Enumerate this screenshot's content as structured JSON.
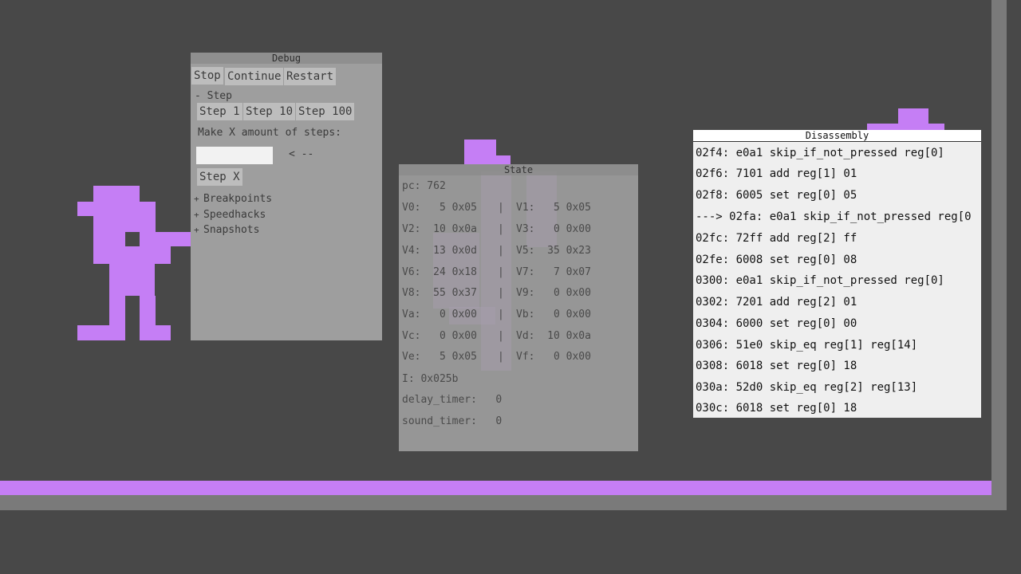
{
  "colors": {
    "background": "#484848",
    "sprite": "#c57ef5",
    "frame": "#7a7a7a",
    "debug_panel": "#9e9e9e",
    "state_panel": "#999999",
    "disassembly_panel": "#efefef"
  },
  "debug": {
    "title": "Debug",
    "buttons": {
      "stop": "Stop",
      "continue": "Continue",
      "restart": "Restart"
    },
    "step_section": "- Step",
    "step_buttons": [
      "Step 1",
      "Step 10",
      "Step 100"
    ],
    "make_steps_label": "Make X amount of steps:",
    "steps_input_value": "",
    "arrow_hint": "< --",
    "step_x_button": "Step X",
    "collapsed_sections": [
      {
        "marker": "+",
        "label": "Breakpoints"
      },
      {
        "marker": "+",
        "label": "Speedhacks"
      },
      {
        "marker": "+",
        "label": "Snapshots"
      }
    ]
  },
  "state": {
    "title": "State",
    "pc": "pc: 762",
    "registers": [
      {
        "left": "V0:   5 0x05",
        "sep": "|",
        "right": "V1:   5 0x05"
      },
      {
        "left": "V2:  10 0x0a",
        "sep": "|",
        "right": "V3:   0 0x00"
      },
      {
        "left": "V4:  13 0x0d",
        "sep": "|",
        "right": "V5:  35 0x23"
      },
      {
        "left": "V6:  24 0x18",
        "sep": "|",
        "right": "V7:   7 0x07"
      },
      {
        "left": "V8:  55 0x37",
        "sep": "|",
        "right": "V9:   0 0x00"
      },
      {
        "left": "Va:   0 0x00",
        "sep": "|",
        "right": "Vb:   0 0x00"
      },
      {
        "left": "Vc:   0 0x00",
        "sep": "|",
        "right": "Vd:  10 0x0a"
      },
      {
        "left": "Ve:   5 0x05",
        "sep": "|",
        "right": "Vf:   0 0x00"
      }
    ],
    "index": "I: 0x025b",
    "delay_timer": "delay_timer:   0",
    "sound_timer": "sound_timer:   0"
  },
  "disassembly": {
    "title": "Disassembly",
    "rows": [
      "02f4: e0a1 skip_if_not_pressed reg[0]",
      "02f6: 7101 add reg[1] 01",
      "02f8: 6005 set reg[0] 05",
      "---> 02fa: e0a1 skip_if_not_pressed reg[0",
      "02fc: 72ff add reg[2] ff",
      "02fe: 6008 set reg[0] 08",
      "0300: e0a1 skip_if_not_pressed reg[0]",
      "0302: 7201 add reg[2] 01",
      "0304: 6000 set reg[0] 00",
      "0306: 51e0 skip_eq reg[1] reg[14]",
      "0308: 6018 set reg[0] 18",
      "030a: 52d0 skip_eq reg[2] reg[13]",
      "030c: 6018 set reg[0] 18"
    ]
  }
}
